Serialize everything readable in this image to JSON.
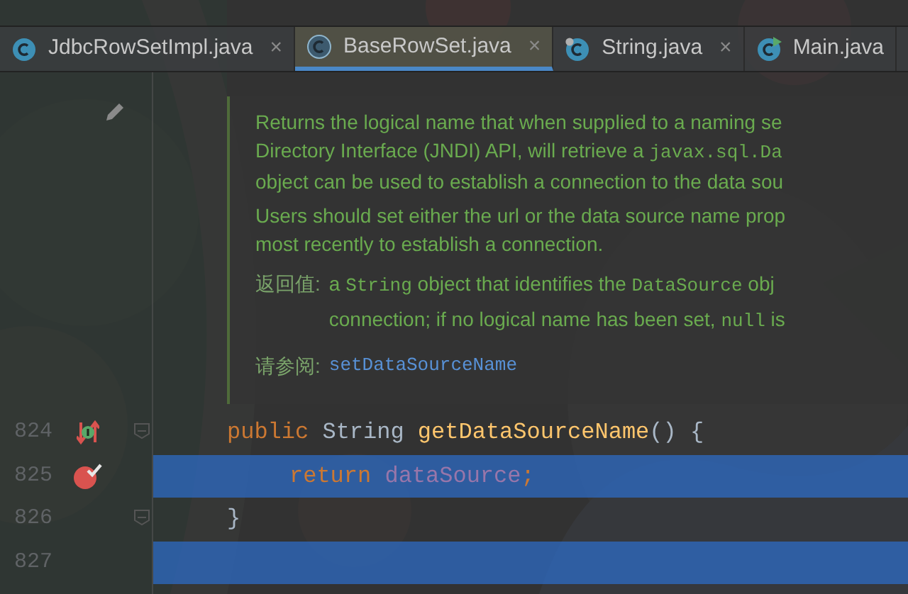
{
  "tabs": [
    {
      "label": "JdbcRowSetImpl.java",
      "selected": false,
      "close": "×",
      "kind": "class"
    },
    {
      "label": "BaseRowSet.java",
      "selected": true,
      "close": "×",
      "kind": "outline"
    },
    {
      "label": "String.java",
      "selected": false,
      "close": "×",
      "kind": "badge"
    },
    {
      "label": "Main.java",
      "selected": false,
      "kind": "run"
    }
  ],
  "doc": {
    "paragraphs": [
      [
        [
          {
            "text": "Returns the logical name that when supplied to a naming se",
            "kind": "text"
          }
        ],
        [
          {
            "text": "Directory Interface (JNDI) API, will retrieve a ",
            "kind": "text"
          },
          {
            "text": "javax.sql.Da",
            "kind": "code"
          }
        ],
        [
          {
            "text": "object can be used to establish a connection to the data sou",
            "kind": "text"
          }
        ]
      ],
      [
        [
          {
            "text": "Users should set either the url or the data source name prop",
            "kind": "text"
          }
        ],
        [
          {
            "text": "most recently to establish a connection.",
            "kind": "text"
          }
        ]
      ]
    ],
    "sections": [
      {
        "label": "返回值:",
        "kind": "text",
        "lines": [
          [
            {
              "text": "a ",
              "kind": "text"
            },
            {
              "text": "String",
              "kind": "code"
            },
            {
              "text": " object that identifies the ",
              "kind": "text"
            },
            {
              "text": "DataSource",
              "kind": "code"
            },
            {
              "text": " obj",
              "kind": "text"
            }
          ],
          [
            {
              "text": "connection; if no logical name has been set, ",
              "kind": "text"
            },
            {
              "text": "null",
              "kind": "code"
            },
            {
              "text": " is",
              "kind": "text"
            }
          ]
        ]
      },
      {
        "label": "请参阅:",
        "kind": "link",
        "link": "setDataSourceName"
      }
    ]
  },
  "lines": [
    {
      "number": "824",
      "kind": "implements",
      "fold": true,
      "highlighted": false,
      "tokens": [
        {
          "text": "public",
          "kind": "keyword"
        },
        {
          "text": " String",
          "kind": "type"
        },
        {
          "text": " getDataSourceName",
          "kind": "method"
        },
        {
          "text": "() {",
          "kind": "plain"
        }
      ]
    },
    {
      "number": "825",
      "kind": "breakpoint",
      "fold": false,
      "highlighted": true,
      "tokens": [
        {
          "text": "return",
          "kind": "keyword"
        },
        {
          "text": " dataSource",
          "kind": "field"
        },
        {
          "text": ";",
          "kind": "keyword"
        }
      ]
    },
    {
      "number": "826",
      "kind": "plain",
      "fold": true,
      "highlighted": false,
      "tokens": [
        {
          "text": "}",
          "kind": "plain"
        }
      ]
    },
    {
      "number": "827",
      "kind": "plain",
      "fold": false,
      "highlighted": true
    }
  ]
}
